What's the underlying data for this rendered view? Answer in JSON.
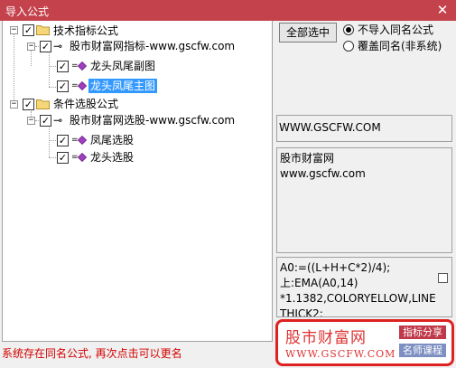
{
  "window": {
    "title": "导入公式",
    "close_glyph": "✕"
  },
  "tree": {
    "groups": [
      {
        "label": "技术指标公式",
        "checked": true,
        "source": {
          "label": "股市财富网指标-www.gscfw.com",
          "checked": true
        },
        "items": [
          {
            "label": "龙头凤尾副图",
            "checked": true,
            "selected": false
          },
          {
            "label": "龙头凤尾主图",
            "checked": true,
            "selected": true
          }
        ]
      },
      {
        "label": "条件选股公式",
        "checked": true,
        "source": {
          "label": "股市财富网选股-www.gscfw.com",
          "checked": true
        },
        "items": [
          {
            "label": "凤尾选股",
            "checked": true,
            "selected": false
          },
          {
            "label": "龙头选股",
            "checked": true,
            "selected": false
          }
        ]
      }
    ],
    "expander_glyph": "−",
    "check_glyph": "✓"
  },
  "options": {
    "select_all_label": "全部选中",
    "radio_skip_label": "不导入同名公式",
    "radio_overwrite_label": "覆盖同名(非系统)",
    "selected_radio": "skip"
  },
  "info": {
    "url": "WWW.GSCFW.COM",
    "description_line1": "股市财富网",
    "description_line2": "www.gscfw.com",
    "code_line1": "A0:=((L+H+C*2)/4);",
    "code_line2": "上:EMA(A0,14)",
    "code_line3": "*1.1382,COLORYELLOW,LINE",
    "code_line4": "THICK2;"
  },
  "status": {
    "message": "系统存在同名公式, 再次点击可以更名"
  },
  "watermark": {
    "cn": "股市财富网",
    "en": "WWW.GSCFW.COM",
    "tag1": "指标分享",
    "tag2": "名师课程",
    "tag1_color": "#c0394a",
    "tag2_color": "#7e8fc2"
  },
  "colors": {
    "titlebar": "#c4424c",
    "selection": "#3399ff",
    "status_text": "#d40000",
    "gem": "#a040c0"
  }
}
